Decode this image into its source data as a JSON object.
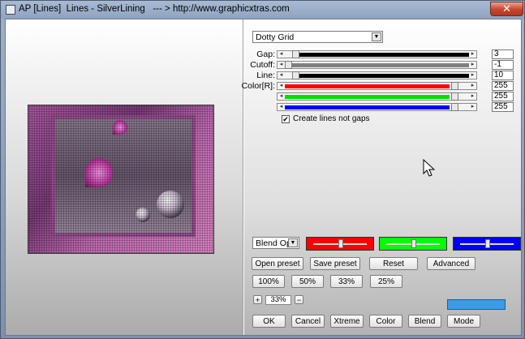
{
  "window": {
    "title": "AP [Lines]  Lines - SilverLining   --- > http://www.graphicxtras.com"
  },
  "effect": {
    "selected": "Dotty Grid"
  },
  "sliders": [
    {
      "label": "Gap:",
      "value": "3",
      "fraction": 0.04,
      "fill": "#000000"
    },
    {
      "label": "Cutoff:",
      "value": "-1",
      "fraction": 0.0,
      "fill": "#808080"
    },
    {
      "label": "Line:",
      "value": "10",
      "fraction": 0.04,
      "fill": "#000000"
    },
    {
      "label": "Color[R]:",
      "value": "255",
      "fraction": 0.93,
      "fill": "#ff0000"
    },
    {
      "label": "",
      "value": "255",
      "fraction": 0.93,
      "fill": "#00e000"
    },
    {
      "label": "",
      "value": "255",
      "fraction": 0.93,
      "fill": "#0000ff"
    }
  ],
  "create_lines": {
    "label": "Create lines not gaps",
    "checked": true,
    "mark": "✔"
  },
  "blend": {
    "selected": "Blend Opti"
  },
  "color_boxes": [
    {
      "color": "#ff0000",
      "fraction": 0.5
    },
    {
      "color": "#00ff00",
      "fraction": 0.5
    },
    {
      "color": "#0000ff",
      "fraction": 0.5
    }
  ],
  "buttons": {
    "open_preset": "Open preset",
    "save_preset": "Save preset",
    "reset": "Reset",
    "advanced": "Advanced",
    "z100": "100%",
    "z50": "50%",
    "z33": "33%",
    "z25": "25%",
    "plus": "+",
    "minus": "−",
    "ok": "OK",
    "cancel": "Cancel",
    "xtreme": "Xtreme",
    "color": "Color",
    "blend": "Blend",
    "mode": "Mode",
    "close": "✕"
  },
  "zoom": {
    "value": "33%"
  },
  "swatch_color": "#3b9be8"
}
